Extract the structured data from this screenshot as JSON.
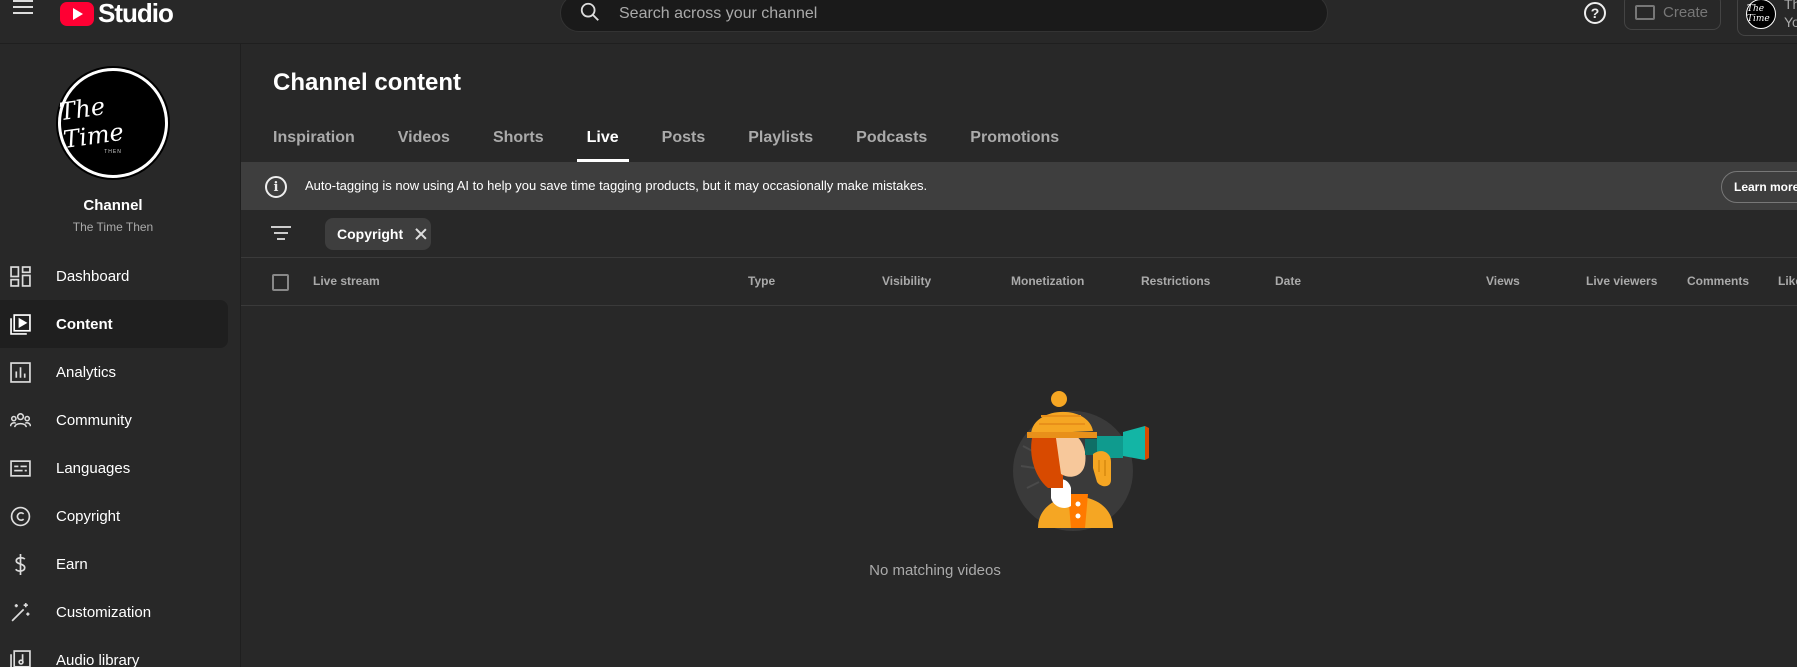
{
  "header": {
    "logo_text": "Studio",
    "search_placeholder": "Search across your channel",
    "help_label": "?",
    "create_label": "Create",
    "account_text_1": "Th",
    "account_text_2": "Yo",
    "account_avatar_text": "The Time"
  },
  "sidebar": {
    "avatar_script": "The Time",
    "avatar_small": "THEN",
    "channel_label": "Channel",
    "channel_name": "The Time Then",
    "items": [
      {
        "label": "Dashboard",
        "icon": "dashboard-icon"
      },
      {
        "label": "Content",
        "icon": "content-icon",
        "active": true
      },
      {
        "label": "Analytics",
        "icon": "analytics-icon"
      },
      {
        "label": "Community",
        "icon": "community-icon"
      },
      {
        "label": "Languages",
        "icon": "languages-icon"
      },
      {
        "label": "Copyright",
        "icon": "copyright-icon"
      },
      {
        "label": "Earn",
        "icon": "earn-icon"
      },
      {
        "label": "Customization",
        "icon": "customization-icon"
      },
      {
        "label": "Audio library",
        "icon": "audio-library-icon"
      }
    ]
  },
  "main": {
    "title": "Channel content",
    "tabs": [
      "Inspiration",
      "Videos",
      "Shorts",
      "Live",
      "Posts",
      "Playlists",
      "Podcasts",
      "Promotions"
    ],
    "active_tab": "Live",
    "banner": {
      "text": "Auto-tagging is now using AI to help you save time tagging products, but it may occasionally make mistakes.",
      "button": "Learn more"
    },
    "filter_chip": "Copyright",
    "columns": [
      "Live stream",
      "Type",
      "Visibility",
      "Monetization",
      "Restrictions",
      "Date",
      "Views",
      "Live viewers",
      "Comments",
      "Likes"
    ],
    "empty_text": "No matching videos"
  },
  "colors": {
    "background": "#282828",
    "banner": "#3e3e3e",
    "brand_red": "#ff0033",
    "illustration_orange": "#f5a623",
    "illustration_teal": "#0f9b8e"
  }
}
